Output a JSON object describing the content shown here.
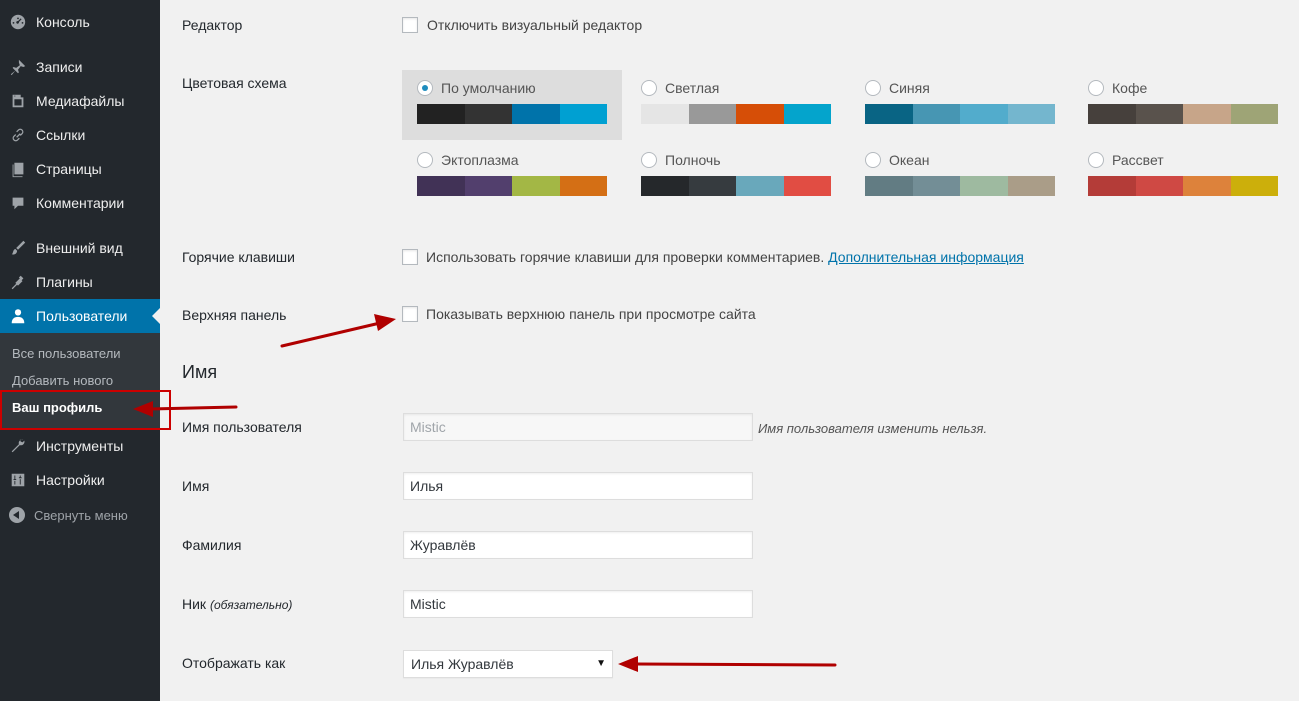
{
  "sidebar": {
    "items": [
      {
        "label": "Консоль",
        "icon": "dashboard-icon"
      },
      {
        "label": "Записи",
        "icon": "pushpin-icon"
      },
      {
        "label": "Медиафайлы",
        "icon": "media-icon"
      },
      {
        "label": "Ссылки",
        "icon": "link-icon"
      },
      {
        "label": "Страницы",
        "icon": "page-icon"
      },
      {
        "label": "Комментарии",
        "icon": "comment-icon"
      },
      {
        "label": "Внешний вид",
        "icon": "paintbrush-icon"
      },
      {
        "label": "Плагины",
        "icon": "plugin-icon"
      },
      {
        "label": "Пользователи",
        "icon": "user-icon"
      },
      {
        "label": "Инструменты",
        "icon": "wrench-icon"
      },
      {
        "label": "Настройки",
        "icon": "settings-icon"
      }
    ],
    "submenu": [
      "Все пользователи",
      "Добавить нового",
      "Ваш профиль"
    ],
    "collapse_label": "Свернуть меню"
  },
  "editor": {
    "label": "Редактор",
    "checkbox_label": "Отключить визуальный редактор"
  },
  "color_scheme": {
    "label": "Цветовая схема",
    "selected": "По умолчанию",
    "schemes": [
      {
        "name": "По умолчанию",
        "colors": [
          "#222222",
          "#333333",
          "#0073aa",
          "#00a0d2"
        ]
      },
      {
        "name": "Светлая",
        "colors": [
          "#e5e5e5",
          "#999999",
          "#d64e07",
          "#04a4cc"
        ]
      },
      {
        "name": "Синяя",
        "colors": [
          "#096484",
          "#4796b3",
          "#52accc",
          "#74b6ce"
        ]
      },
      {
        "name": "Кофе",
        "colors": [
          "#46403c",
          "#59524c",
          "#c7a589",
          "#9ea476"
        ]
      },
      {
        "name": "Эктоплазма",
        "colors": [
          "#413256",
          "#523f6d",
          "#a3b745",
          "#d46f15"
        ]
      },
      {
        "name": "Полночь",
        "colors": [
          "#25282b",
          "#363b3f",
          "#69a8bb",
          "#e14d43"
        ]
      },
      {
        "name": "Океан",
        "colors": [
          "#627c83",
          "#738e96",
          "#9ebaa0",
          "#aa9d88"
        ]
      },
      {
        "name": "Рассвет",
        "colors": [
          "#b43c38",
          "#cf4944",
          "#dd823b",
          "#ccaf0b"
        ]
      }
    ]
  },
  "hotkeys": {
    "label": "Горячие клавиши",
    "checkbox_label": "Использовать горячие клавиши для проверки комментариев.",
    "link": "Дополнительная информация"
  },
  "toolbar": {
    "label": "Верхняя панель",
    "checkbox_label": "Показывать верхнюю панель при просмотре сайта"
  },
  "name_section": {
    "title": "Имя",
    "username_label": "Имя пользователя",
    "username_value": "Mistic",
    "username_note": "Имя пользователя изменить нельзя.",
    "first_name_label": "Имя",
    "first_name_value": "Илья",
    "last_name_label": "Фамилия",
    "last_name_value": "Журавлёв",
    "nickname_label": "Ник",
    "nickname_required": "(обязательно)",
    "nickname_value": "Mistic",
    "display_label": "Отображать как",
    "display_value": "Илья Журавлёв"
  },
  "annotation_color": "#b00000"
}
